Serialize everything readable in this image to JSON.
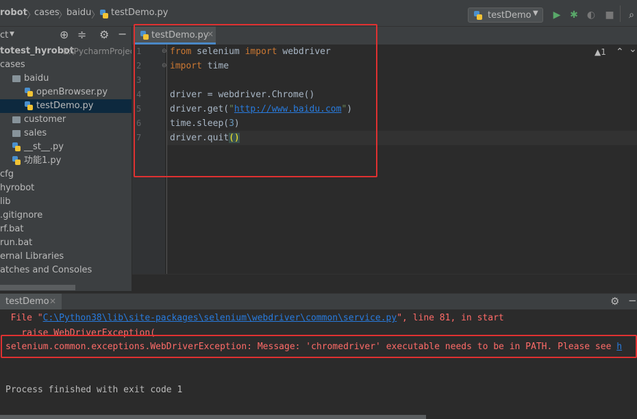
{
  "breadcrumb": [
    "robot",
    "cases",
    "baidu",
    "testDemo.py"
  ],
  "run_config": "testDemo",
  "project_header": "ct",
  "tree": [
    {
      "label": "totest_hyrobot",
      "extra": "E:\\PycharmProjec",
      "icon": "none",
      "indent": 0,
      "bold": true
    },
    {
      "label": "cases",
      "icon": "none",
      "indent": 0
    },
    {
      "label": "baidu",
      "icon": "folder",
      "indent": 1
    },
    {
      "label": "openBrowser.py",
      "icon": "py",
      "indent": 2
    },
    {
      "label": "testDemo.py",
      "icon": "py",
      "indent": 2,
      "selected": true
    },
    {
      "label": "customer",
      "icon": "folder",
      "indent": 1
    },
    {
      "label": "sales",
      "icon": "folder",
      "indent": 1
    },
    {
      "label": "__st__.py",
      "icon": "py",
      "indent": 1
    },
    {
      "label": "功能1.py",
      "icon": "py",
      "indent": 1
    },
    {
      "label": "cfg",
      "icon": "none",
      "indent": 0
    },
    {
      "label": "hyrobot",
      "icon": "none",
      "indent": 0
    },
    {
      "label": "lib",
      "icon": "none",
      "indent": 0
    },
    {
      "label": ".gitignore",
      "icon": "none",
      "indent": 0
    },
    {
      "label": "rf.bat",
      "icon": "none",
      "indent": 0
    },
    {
      "label": "run.bat",
      "icon": "none",
      "indent": 0
    },
    {
      "label": "ernal Libraries",
      "icon": "none",
      "indent": 0
    },
    {
      "label": "atches and Consoles",
      "icon": "none",
      "indent": 0
    }
  ],
  "editor": {
    "tab_label": "testDemo.py",
    "warnings": "▲1",
    "line_numbers": [
      "1",
      "2",
      "3",
      "4",
      "5",
      "6",
      "7"
    ],
    "code": {
      "l1_kw1": "from",
      "l1_mod": " selenium ",
      "l1_kw2": "import",
      "l1_rest": " webdriver",
      "l2_kw": "import",
      "l2_rest": " time",
      "l4": "driver = webdriver.Chrome()",
      "l5_pre": "driver.get(",
      "l5_q1": "\"",
      "l5_url": "http://www.baidu.com",
      "l5_q2": "\"",
      "l5_post": ")",
      "l6_pre": "time.sleep(",
      "l6_num": "3",
      "l6_post": ")",
      "l7_pre": "driver.quit",
      "l7_paren": "()"
    }
  },
  "run_panel": {
    "tab_label": "testDemo",
    "line1_pre": "  File \"",
    "line1_link": "C:\\Python38\\lib\\site-packages\\selenium\\webdriver\\common\\service.py",
    "line1_post": "\", line 81, in start",
    "line2": "    raise WebDriverException(",
    "line3": "selenium.common.exceptions.WebDriverException: Message: 'chromedriver' executable needs to be in PATH. Please see ",
    "line3_link": "h",
    "line4": "Process finished with exit code 1"
  },
  "colors": {
    "accent": "#4a88c7",
    "error": "#ff6b68",
    "link": "#287bde",
    "highlight_box": "#e03131"
  }
}
